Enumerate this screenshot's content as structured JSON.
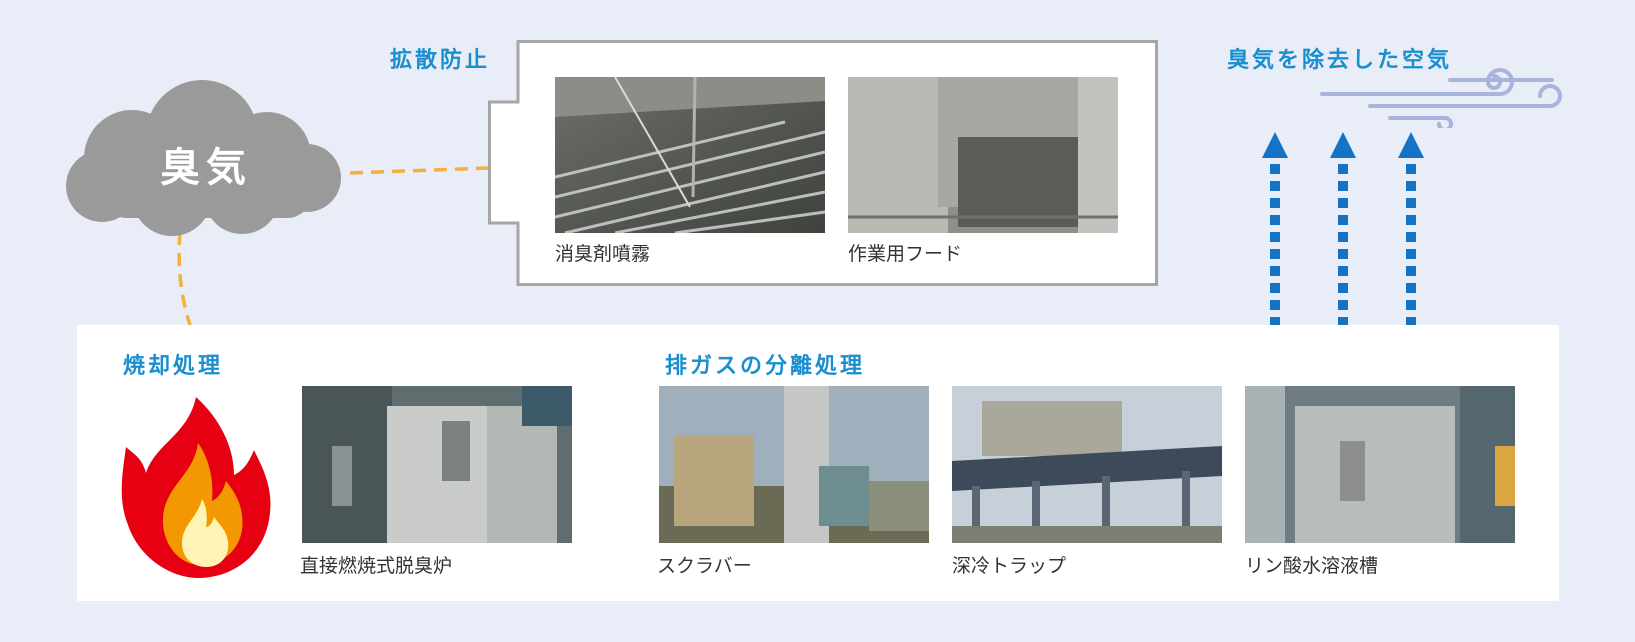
{
  "cloud_label": "臭気",
  "prevention": {
    "title": "拡散防止",
    "items": [
      {
        "caption": "消臭剤噴霧"
      },
      {
        "caption": "作業用フード"
      }
    ]
  },
  "clean_air": {
    "title": "臭気を除去した空気"
  },
  "incineration": {
    "title": "焼却処理",
    "items": [
      {
        "caption": "直接燃焼式脱臭炉"
      }
    ]
  },
  "separation": {
    "title": "排ガスの分離処理",
    "items": [
      {
        "caption": "スクラバー"
      },
      {
        "caption": "深冷トラップ"
      },
      {
        "caption": "リン酸水溶液槽"
      }
    ]
  },
  "colors": {
    "background": "#e9edf7",
    "accent_blue": "#1a8fd0",
    "arrow_blue": "#1473c4",
    "dash_orange": "#f3b03a",
    "cloud_gray": "#9a9a9a",
    "frame_gray": "#a6a6a6",
    "wind_lilac": "#a9b4dd"
  },
  "icons": [
    "odor-cloud-icon",
    "fire-icon",
    "wind-icon",
    "up-arrow-icon"
  ]
}
